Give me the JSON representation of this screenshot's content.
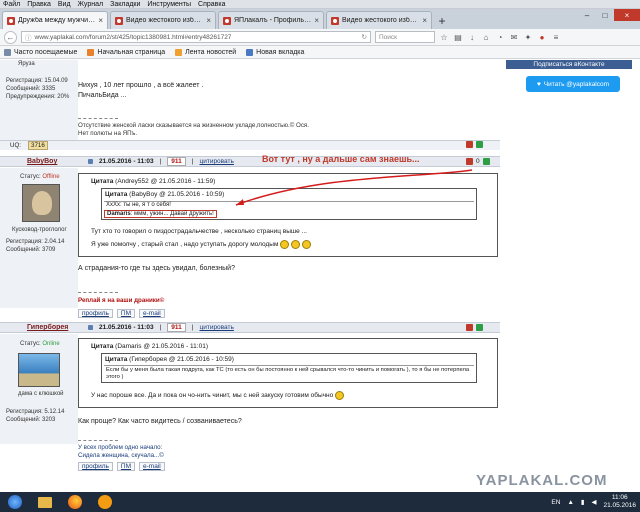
{
  "menu": [
    "Файл",
    "Правка",
    "Вид",
    "Журнал",
    "Закладки",
    "Инструменты",
    "Справка"
  ],
  "tabs": [
    {
      "title": "Дружба между мужчино...",
      "active": true
    },
    {
      "title": "Видео жестокого избиен...",
      "active": false
    },
    {
      "title": "ЯПлакалъ - Профиль пол...",
      "active": false
    },
    {
      "title": "Видео жестокого избиен...",
      "active": false
    }
  ],
  "nav": {
    "url": "www.yaplakal.com/forum2/st/425/topic1380981.html#entry48261727",
    "search_placeholder": "Поиск"
  },
  "bookmarks": [
    "Часто посещаемые",
    "Начальная страница",
    "Лента новостей",
    "Новая вкладка"
  ],
  "sidebar": {
    "subscribe": "Подписаться вКонтакте",
    "twitter": "Читать @yaplakalcom"
  },
  "post_prev": {
    "user_name": "Яруза",
    "registration": "Регистрация: 15.04.09",
    "messages": "Сообщений: 3335",
    "warnings": "Предупреждения: 20%",
    "text1": "Нихуя , 10 лет прошло , а всё жалеет .",
    "text2": "ПичальБида ...",
    "sig1": "Отсутствие женской ласки сказывается на жизненном укладе,полностью.© Ося.",
    "sig2": "Нет полюты на ЯПъ.",
    "uq_label": "UQ:",
    "uq_value": "3716"
  },
  "post1": {
    "nick": "BabyBoy",
    "date": "21.05.2016 - 11:03",
    "num": "911",
    "cite": "цитировать",
    "rating": "0",
    "status_label": "Статус:",
    "status": "Offline",
    "title": "Кусковод-троглолог",
    "registration": "Регистрация: 2.04.14",
    "messages": "Сообщений: 3709",
    "q_outer_title": "Цитата",
    "q_outer_meta": "(Andrey552 @ 21.05.2016 - 11:59)",
    "q_inner_title": "Цитата",
    "q_inner_meta": "(BabyBoy @ 21.05.2016 - 10:59)",
    "q_inner_line1": "XxXx: ты не, я т о себя!",
    "q_inner_line2_name": "Damaris",
    "q_inner_line2": ": ммм, ужин... Давай дружить!",
    "q_text1": "Тут хто то говорил о пиздострадальчестве , несколько страниц выше ...",
    "q_text2": "Я уже помолчу , старый стал , надо уступать дорогу молодым",
    "text": "А страдания-то где ты здесь увидал, болезный?",
    "sig": "Реплай я на ваши драники©",
    "annotation": "Вот тут , ну а дальше сам знаешь..."
  },
  "post2": {
    "nick": "Гиперборея",
    "date": "21.05.2016 - 11:03",
    "num": "911",
    "cite": "цитировать",
    "status_label": "Статус:",
    "status": "Online",
    "title": "дама с клюшкой",
    "registration": "Регистрация: 5.12.14",
    "messages": "Сообщений: 3203",
    "q_outer_title": "Цитата",
    "q_outer_meta": "(Damaris @ 21.05.2016 - 11:01)",
    "q_inner_title": "Цитата",
    "q_inner_meta": "(Гиперборея @ 21.05.2016 - 10:59)",
    "q_inner_text": "Если бы у меня была такая подруга, как ТС (то есть он бы постоянно к ней срывался что-то чинить и помогать ), то я бы не потерпела этого )",
    "q_text": "У нас пороше все. Да и пока он чо-нить чинит, мы с ней закуску готовим обычно",
    "text": "Как проще? Как часто видитесь / созваниваетесь?",
    "sig1": "У всех проблем одно начало:",
    "sig2": "Сидела женщина, скучала...©"
  },
  "footer_links": {
    "profile": "профиль",
    "pm": "ПМ",
    "email": "e-mail"
  },
  "watermark": "YAPLAKAL.COM",
  "taskbar": {
    "lang": "EN",
    "time": "11:06",
    "date": "21.05.2016"
  }
}
